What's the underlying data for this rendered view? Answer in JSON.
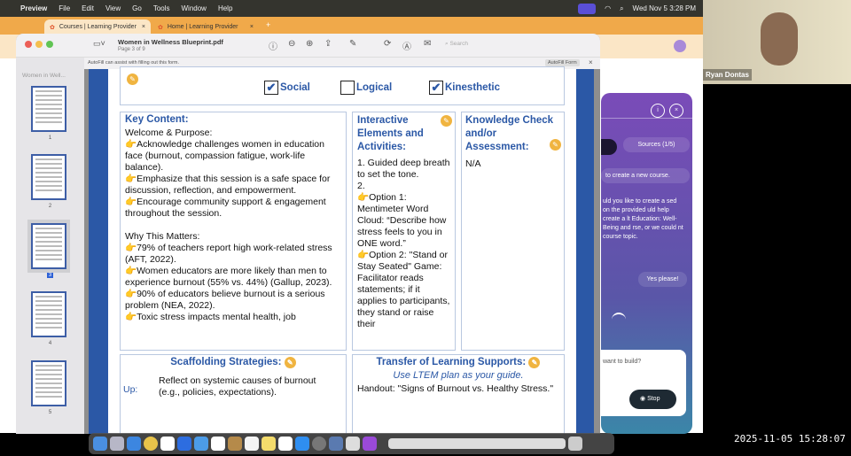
{
  "menubar": {
    "app": "Preview",
    "items": [
      "File",
      "Edit",
      "View",
      "Go",
      "Tools",
      "Window",
      "Help"
    ],
    "datetime": "Wed Nov 5  3:28 PM"
  },
  "browser": {
    "tabs": [
      "Courses | Learning Provider",
      "Home | Learning Provider"
    ],
    "new_tab": "+",
    "close": "×"
  },
  "preview": {
    "title": "Women in Wellness Blueprint.pdf",
    "subtitle": "Page 3 of 9",
    "search_placeholder": "Search",
    "autofill_msg": "AutoFill can assist with filling out this form.",
    "autofill_btn": "AutoFill Form",
    "sidebar_title": "Women in Well...",
    "pages": [
      "1",
      "2",
      "3",
      "4",
      "5"
    ],
    "current_page": 3
  },
  "document": {
    "checkboxes": [
      {
        "label": "Social",
        "checked": true
      },
      {
        "label": "Logical",
        "checked": false
      },
      {
        "label": "Kinesthetic",
        "checked": true
      }
    ],
    "key_content": {
      "heading": "Key Content:",
      "lines": [
        "Welcome & Purpose:",
        "👉Acknowledge challenges women in education face (burnout, compassion fatigue, work-life balance).",
        "👉Emphasize that this session is a safe space for discussion, reflection, and empowerment.",
        "👉Encourage community support & engagement throughout the session.",
        "",
        "Why This Matters:",
        "👉79% of teachers report high work-related stress (AFT, 2022).",
        "👉Women educators are more likely than men to experience burnout (55% vs. 44%) (Gallup, 2023).",
        "👉90% of educators believe burnout is a serious problem (NEA, 2022).",
        "👉Toxic stress impacts mental health, job"
      ]
    },
    "interactive": {
      "heading": "Interactive Elements and Activities:",
      "lines": [
        "1. Guided deep breath to set the tone.",
        "2.",
        "👉Option 1: Mentimeter Word Cloud: “Describe how stress feels to you in ONE word.”",
        "👉Option 2: \"Stand or Stay Seated\" Game: Facilitator reads statements; if it applies to participants, they stand or raise their"
      ]
    },
    "knowledge": {
      "heading": "Knowledge Check and/or Assessment:",
      "value": "N/A"
    },
    "scaffolding": {
      "heading": "Scaffolding Strategies:",
      "label": "Up:",
      "text": "Reflect on systemic causes of burnout (e.g., policies, expectations)."
    },
    "transfer": {
      "heading": "Transfer of Learning Supports:",
      "subheading": "Use LTEM plan as your guide.",
      "text": "Handout: \"Signs of Burnout vs. Healthy Stress.\""
    }
  },
  "assistant": {
    "sources": "Sources (1/5)",
    "msg1": "to create a new course.",
    "msg2": "uld you like to create a sed on the provided uld help create a lt Education: Well-Being and rse, or we could nt course topic.",
    "user_msg": "Yes please!",
    "input_placeholder": "want to build?",
    "stop": "Stop"
  },
  "video": {
    "name": "Ryan Dontas"
  },
  "timestamp": "2025-11-05 15:28:07"
}
